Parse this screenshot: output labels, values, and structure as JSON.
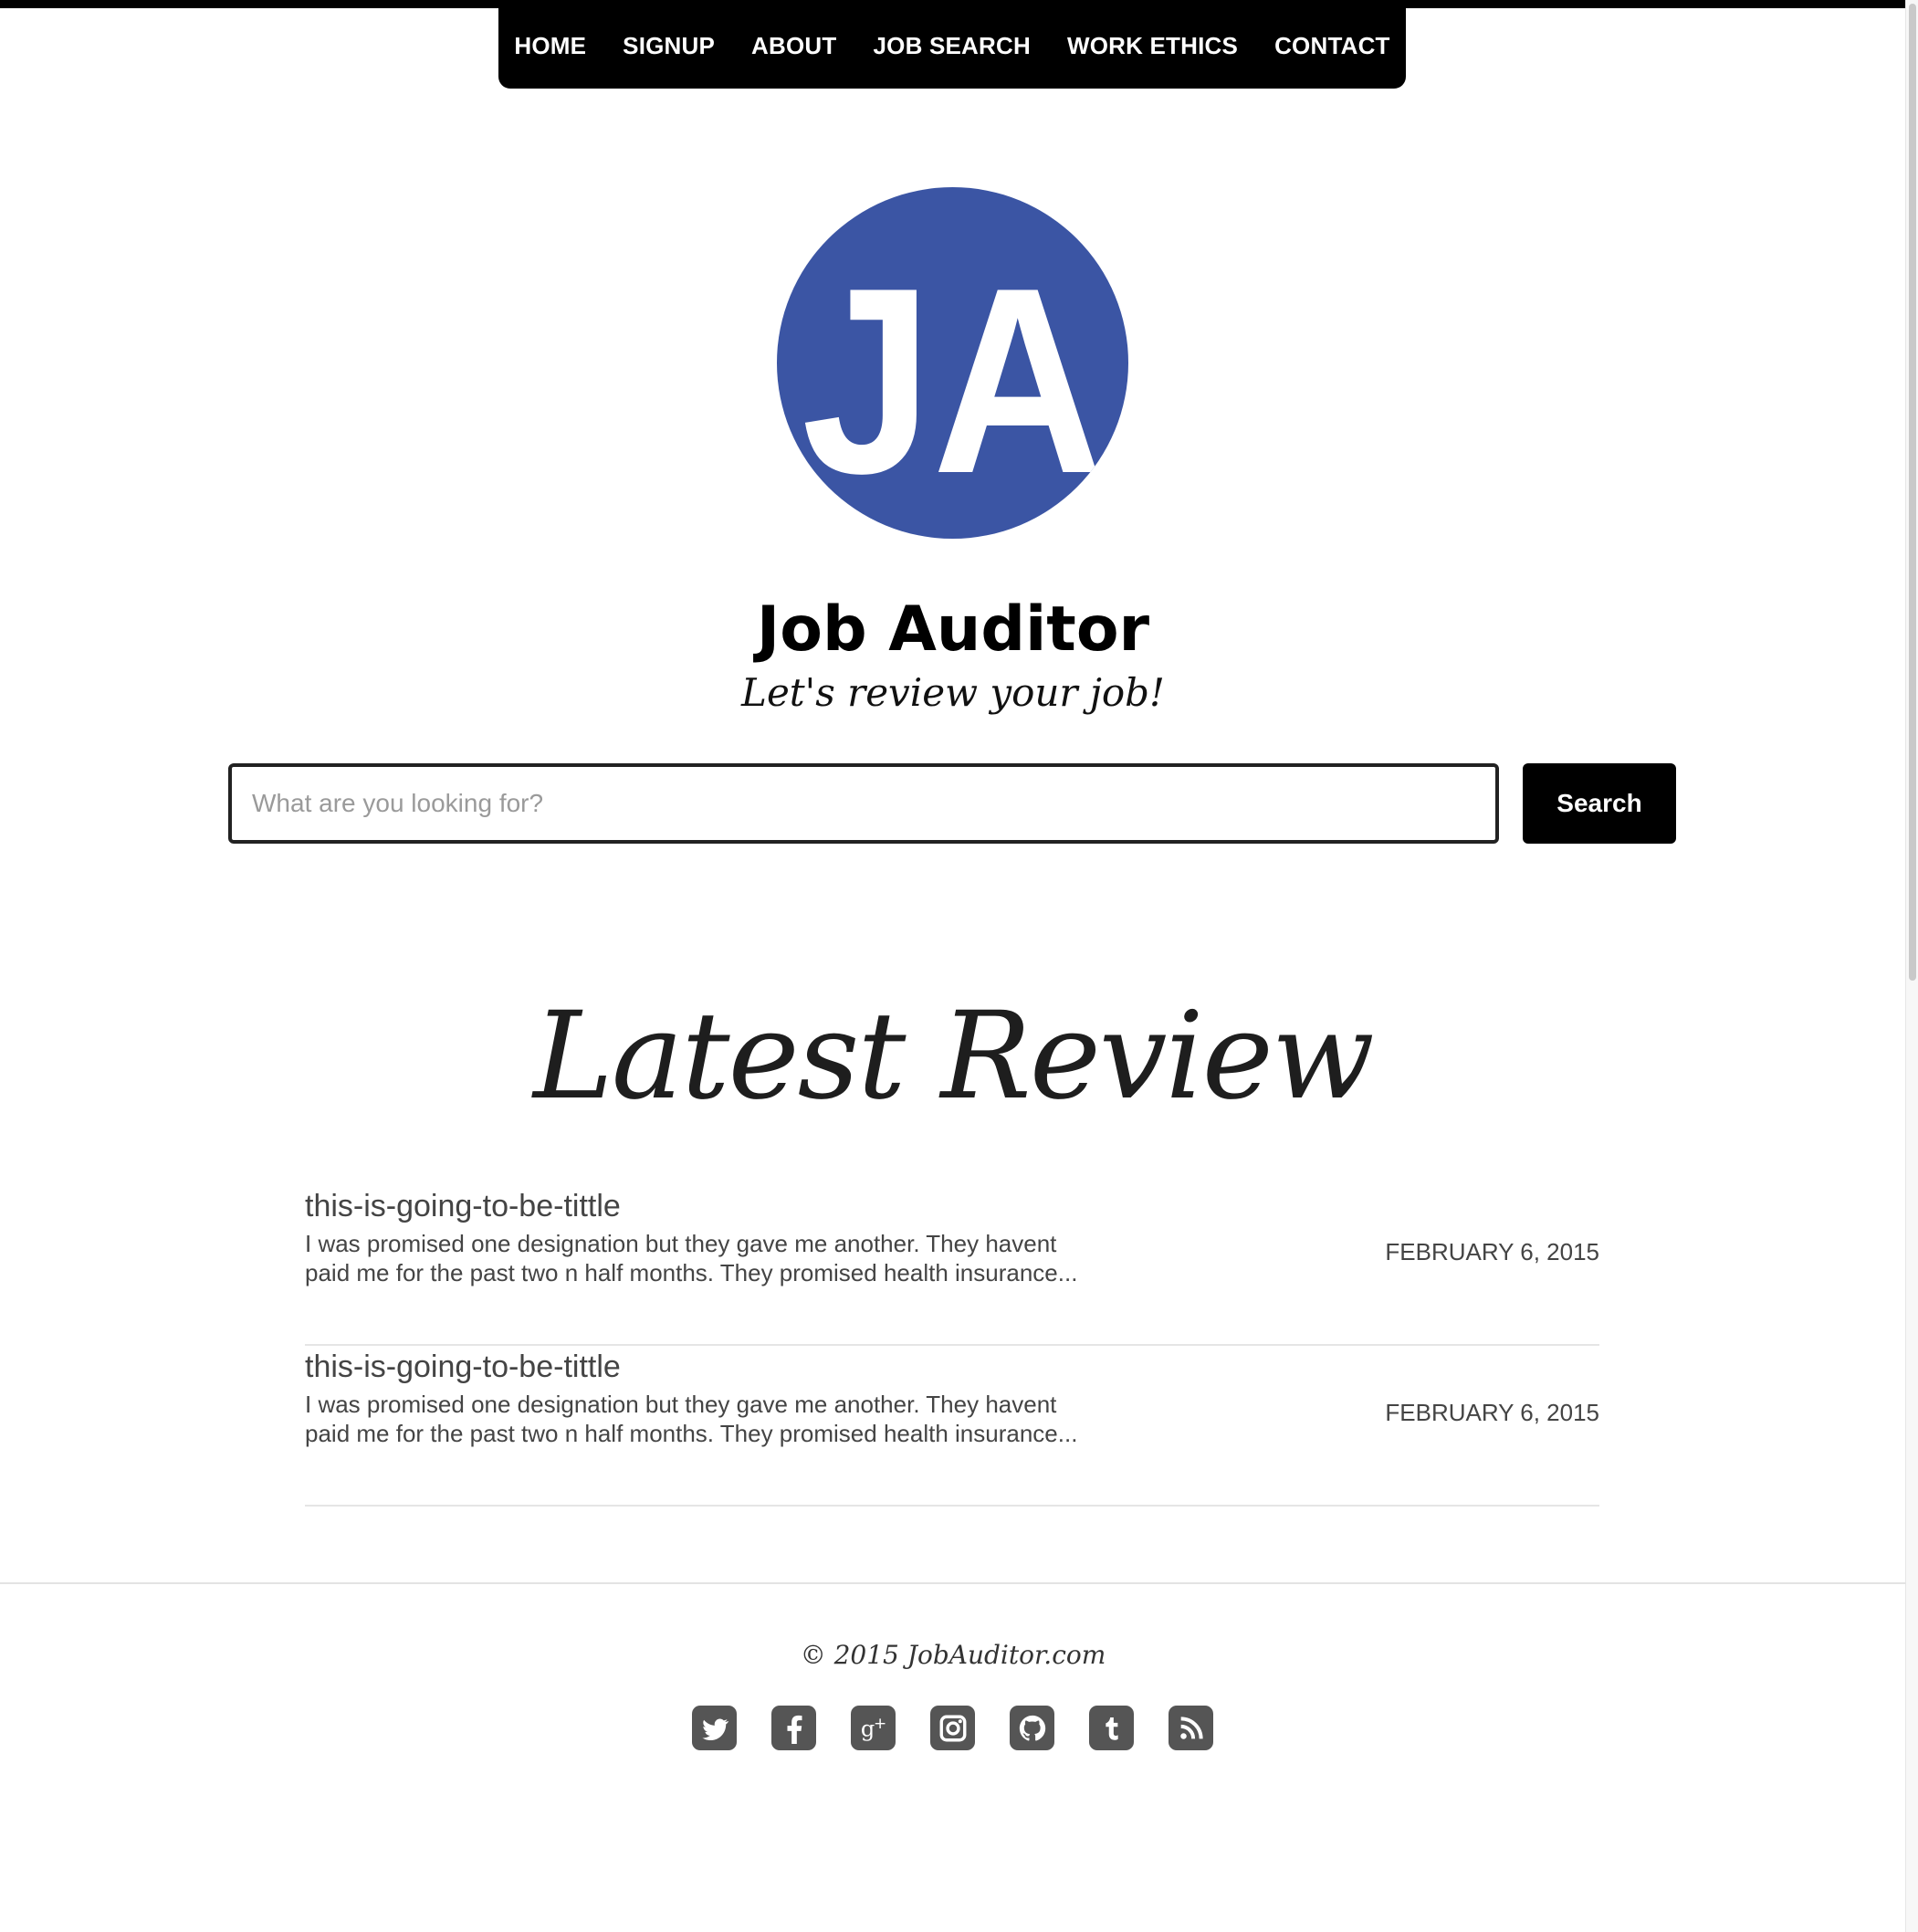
{
  "nav": {
    "items": [
      {
        "label": "HOME"
      },
      {
        "label": "SIGNUP"
      },
      {
        "label": "ABOUT"
      },
      {
        "label": "JOB SEARCH"
      },
      {
        "label": "WORK ETHICS"
      },
      {
        "label": "CONTACT"
      }
    ]
  },
  "brand": {
    "logo_text": "JA",
    "title": "Job Auditor",
    "tagline": "Let's review your job!",
    "logo_color": "#3b55a4"
  },
  "search": {
    "placeholder": "What are you looking for?",
    "value": "",
    "button_label": "Search"
  },
  "latest": {
    "title": "Latest Review",
    "reviews": [
      {
        "title": "this-is-going-to-be-tittle",
        "excerpt": "I was promised one designation but they gave me another. They havent paid me for the past two n half months. They promised health insurance...",
        "date": "FEBRUARY 6, 2015"
      },
      {
        "title": "this-is-going-to-be-tittle",
        "excerpt": "I was promised one designation but they gave me another. They havent paid me for the past two n half months. They promised health insurance...",
        "date": "FEBRUARY 6, 2015"
      }
    ]
  },
  "footer": {
    "copyright": "© 2015 JobAuditor.com",
    "social_icons": [
      "twitter-icon",
      "facebook-icon",
      "google-plus-icon",
      "instagram-icon",
      "github-icon",
      "tumblr-icon",
      "rss-icon"
    ]
  }
}
